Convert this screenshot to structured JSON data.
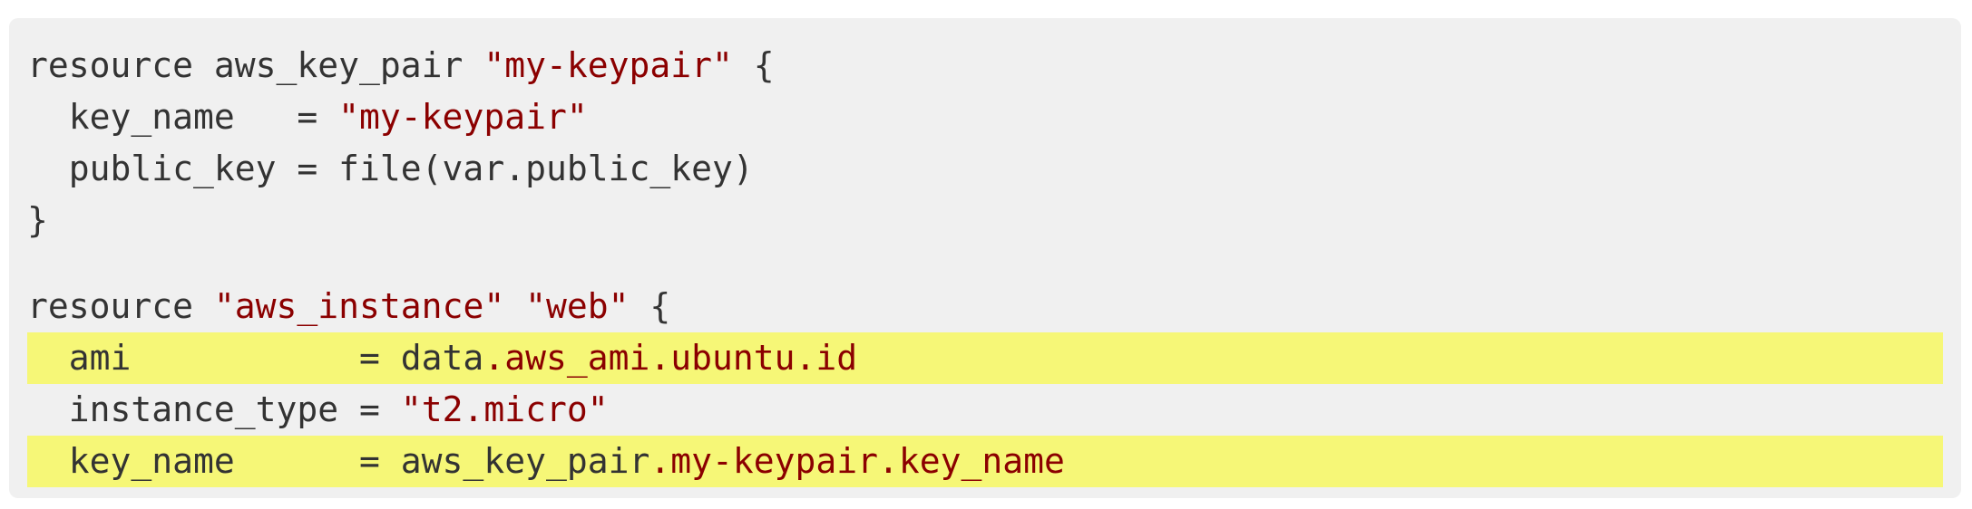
{
  "colors": {
    "background": "#f0f0f0",
    "text": "#333333",
    "string": "#8b0000",
    "highlight": "#f6f777"
  },
  "code": {
    "line1": {
      "a": "resource aws_key_pair ",
      "b": "\"my-keypair\"",
      "c": " {"
    },
    "line2": {
      "a": "  key_name   = ",
      "b": "\"my-keypair\""
    },
    "line3": {
      "a": "  public_key = file(var.public_key)"
    },
    "line4": {
      "a": "}"
    },
    "line6": {
      "a": "resource ",
      "b": "\"aws_instance\"",
      "c": " ",
      "d": "\"web\"",
      "e": " {"
    },
    "line7": {
      "a": "  ami           = data",
      "b": ".aws_ami.ubuntu.id"
    },
    "line8": {
      "a": "  instance_type = ",
      "b": "\"t2.micro\""
    },
    "line9": {
      "a": "  key_name      = aws_key_pair",
      "b": ".my-keypair.key_name"
    }
  }
}
